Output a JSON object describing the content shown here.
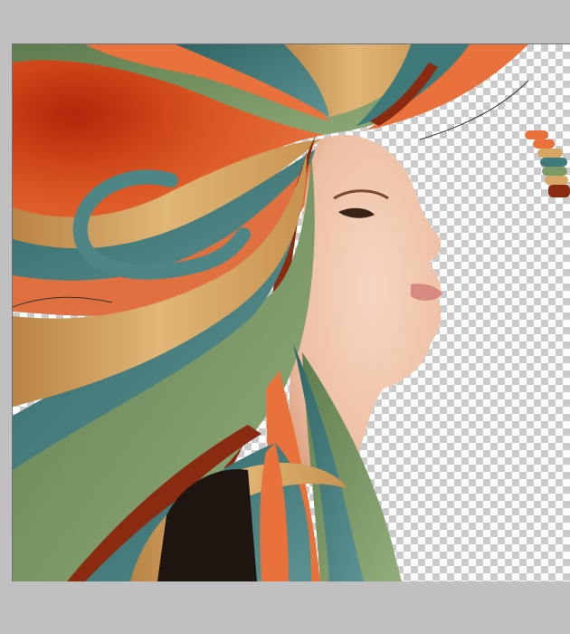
{
  "canvas": {
    "background": "#c0c0c0",
    "transparency_checker": [
      "#ffffff",
      "#cbcbcb"
    ]
  },
  "palette": {
    "orange": "#e8713c",
    "burnt_orange": "#c8471a",
    "rust": "#8a2a10",
    "teal": "#3f7a7a",
    "teal_light": "#5c9292",
    "sage": "#7e9a68",
    "tan": "#d6a664",
    "tan_dark": "#b98446",
    "skin": "#f0c7ad"
  },
  "swatches": [
    "#e8713c",
    "#d6a664",
    "#3f7a7a",
    "#7e9a68",
    "#d6a664",
    "#8a2a10"
  ]
}
